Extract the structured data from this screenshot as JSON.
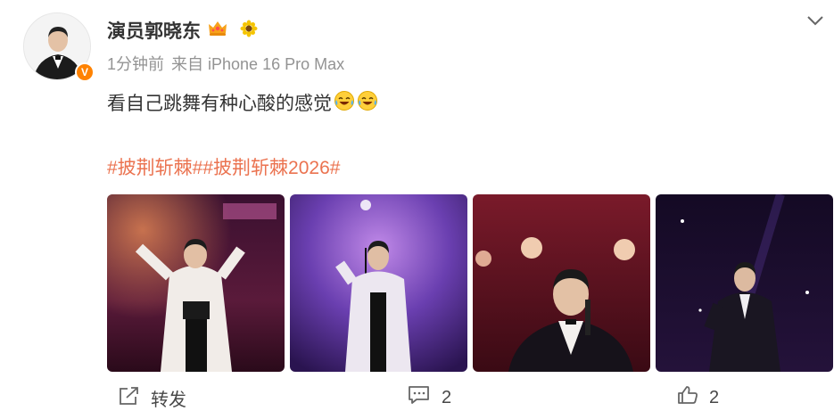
{
  "post": {
    "username": "演员郭晓东",
    "meta_time": "1分钟前",
    "meta_source": "来自 iPhone 16 Pro Max",
    "content_text": "看自己跳舞有种心酸的感觉",
    "hashtags": "#披荆斩棘##披荆斩棘2026#",
    "verified_badge": "V",
    "icons": {
      "crown": "crown-icon",
      "badge": "sunflower-icon",
      "chevron": "chevron-down-icon",
      "emoji": "laugh-cry-emoji"
    },
    "photos": [
      {
        "name": "photo-1",
        "theme": "white-jacket-dance"
      },
      {
        "name": "photo-2",
        "theme": "white-jacket-mic-stand"
      },
      {
        "name": "photo-3",
        "theme": "black-suit-closeup"
      },
      {
        "name": "photo-4",
        "theme": "black-suit-dark-stage"
      }
    ]
  },
  "actions": {
    "repost_label": "转发",
    "comment_count": "2",
    "like_count": "2"
  },
  "colors": {
    "hashtag": "#eb7350",
    "meta": "#939393",
    "badge": "#ff8200"
  }
}
